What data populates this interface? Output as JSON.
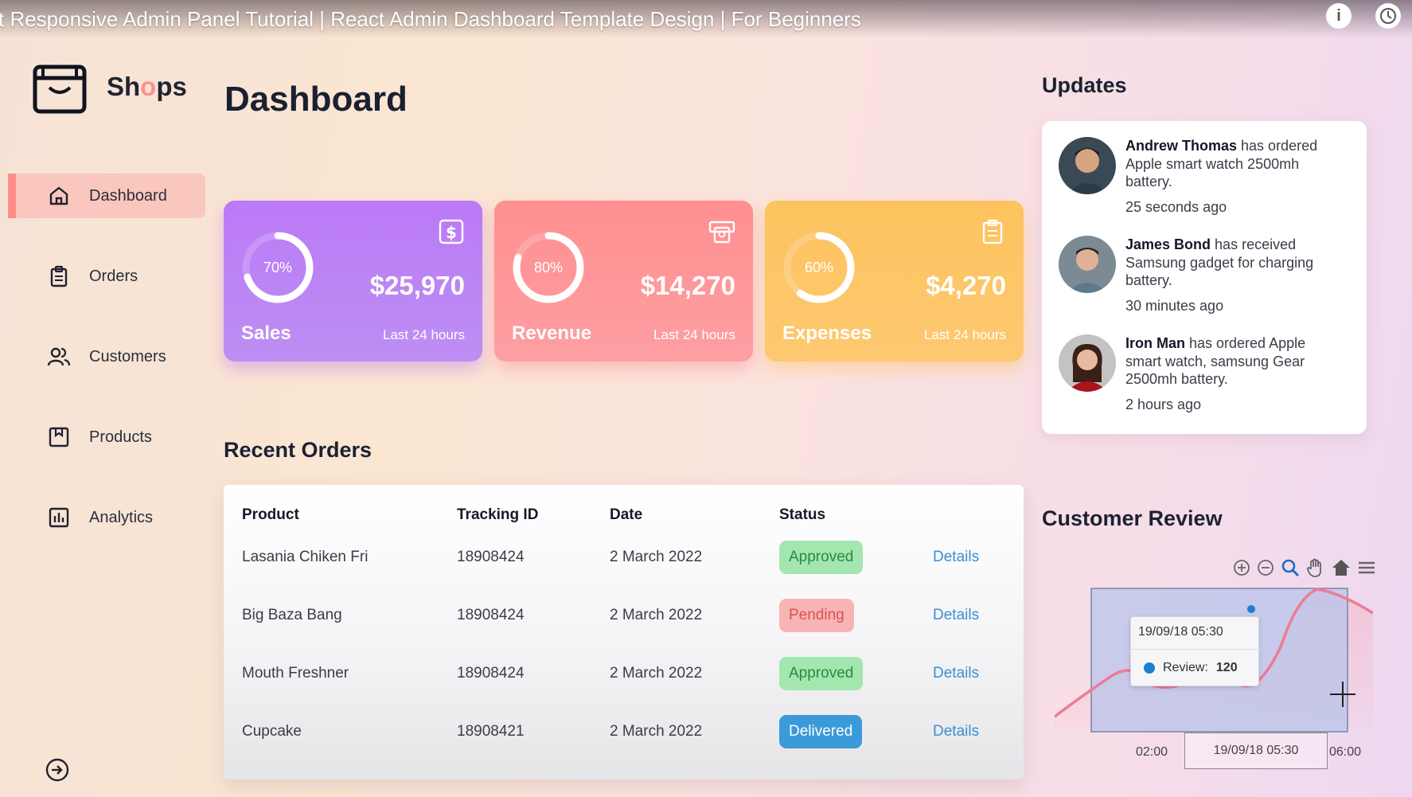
{
  "video": {
    "title": "t Responsive Admin Panel Tutorial | React Admin Dashboard Template Design | For Beginners",
    "info_icon": "info-icon",
    "clock_icon": "clock-icon"
  },
  "brand": {
    "name_pre": "Sh",
    "name_accent": "o",
    "name_post": "ps",
    "logo_icon": "shopping-bag-icon",
    "accent_color": "#ff8f8f"
  },
  "sidebar": {
    "items": [
      {
        "label": "Dashboard",
        "icon": "home-icon",
        "active": true
      },
      {
        "label": "Orders",
        "icon": "clipboard-icon",
        "active": false
      },
      {
        "label": "Customers",
        "icon": "users-icon",
        "active": false
      },
      {
        "label": "Products",
        "icon": "package-icon",
        "active": false
      },
      {
        "label": "Analytics",
        "icon": "bar-chart-icon",
        "active": false
      }
    ],
    "logout_icon": "sign-out-icon"
  },
  "main": {
    "title": "Dashboard"
  },
  "cards": [
    {
      "title": "Sales",
      "percent": "70%",
      "value": 70,
      "amount": "$25,970",
      "period": "Last 24 hours",
      "icon": "dollar-icon",
      "color": "#bb79f6"
    },
    {
      "title": "Revenue",
      "percent": "80%",
      "value": 80,
      "amount": "$14,270",
      "period": "Last 24 hours",
      "icon": "money-icon",
      "color": "#ff8f90"
    },
    {
      "title": "Expenses",
      "percent": "60%",
      "value": 60,
      "amount": "$4,270",
      "period": "Last 24 hours",
      "icon": "clipboard-icon",
      "color": "#fdc35e"
    }
  ],
  "recent_orders": {
    "title": "Recent Orders",
    "columns": [
      "Product",
      "Tracking ID",
      "Date",
      "Status"
    ],
    "rows": [
      {
        "product": "Lasania Chiken Fri",
        "tracking": "18908424",
        "date": "2 March 2022",
        "status": "Approved",
        "details": "Details"
      },
      {
        "product": "Big Baza Bang",
        "tracking": "18908424",
        "date": "2 March 2022",
        "status": "Pending",
        "details": "Details"
      },
      {
        "product": "Mouth Freshner",
        "tracking": "18908424",
        "date": "2 March 2022",
        "status": "Approved",
        "details": "Details"
      },
      {
        "product": "Cupcake",
        "tracking": "18908421",
        "date": "2 March 2022",
        "status": "Delivered",
        "details": "Details"
      }
    ]
  },
  "updates": {
    "title": "Updates",
    "items": [
      {
        "name": "Andrew Thomas",
        "text": " has ordered Apple smart watch 2500mh battery.",
        "time": "25 seconds ago"
      },
      {
        "name": "James Bond",
        "text": " has received Samsung gadget for charging battery.",
        "time": "30 minutes ago"
      },
      {
        "name": "Iron Man",
        "text": " has ordered Apple smart watch, samsung Gear 2500mh battery.",
        "time": "2 hours ago"
      }
    ]
  },
  "customer_review": {
    "title": "Customer Review",
    "tools": [
      "zoom-in-icon",
      "zoom-out-icon",
      "magnifier-icon",
      "pan-hand-icon",
      "home-icon",
      "menu-icon"
    ],
    "tooltip": {
      "date": "19/09/18 05:30",
      "series": "Review:",
      "value": "120"
    },
    "x_labels": [
      "02:00",
      "19/09/18 05:30",
      "06:00"
    ]
  }
}
